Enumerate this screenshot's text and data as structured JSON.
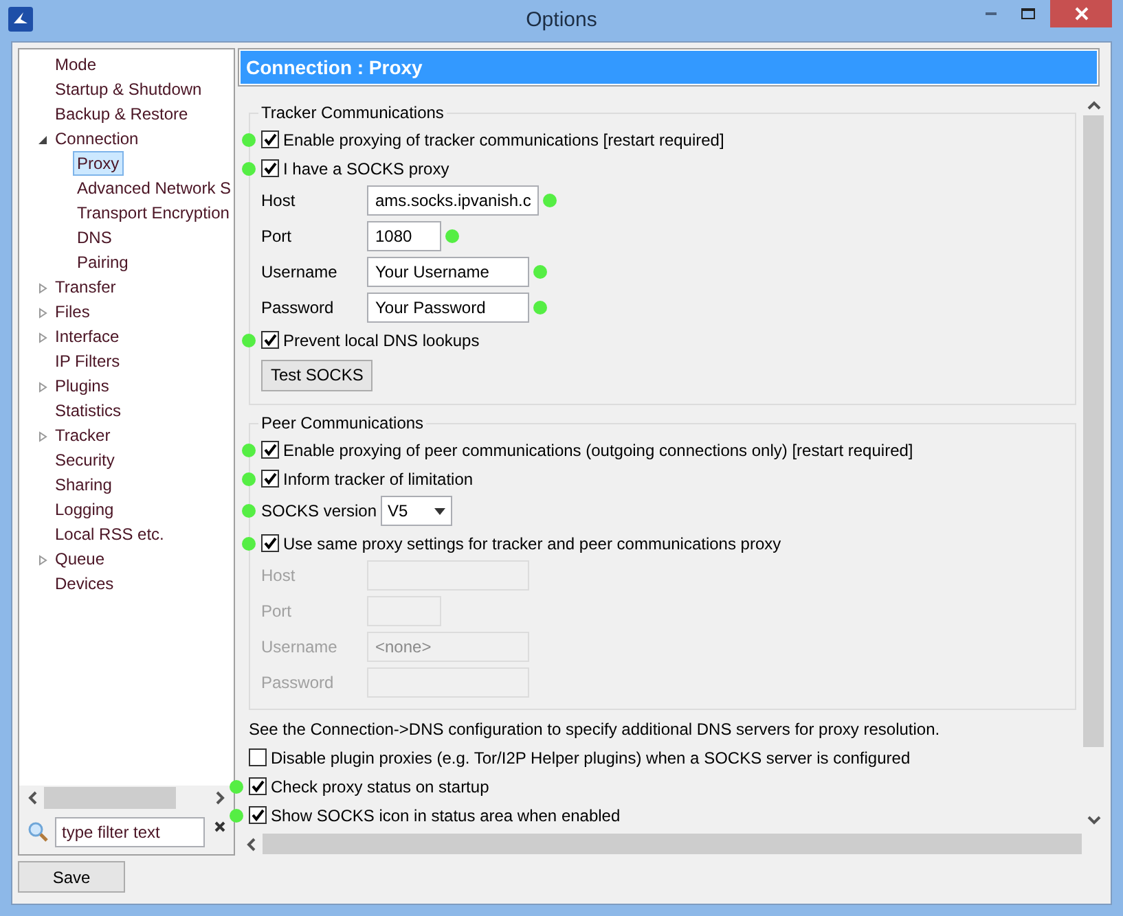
{
  "window": {
    "title": "Options"
  },
  "sidebar": {
    "items": [
      {
        "label": "Mode",
        "kind": "page",
        "selected": false
      },
      {
        "label": "Startup & Shutdown",
        "kind": "page",
        "selected": false
      },
      {
        "label": "Backup & Restore",
        "kind": "page",
        "selected": false
      },
      {
        "label": "Connection",
        "kind": "group",
        "expanded": true,
        "selected": false,
        "children": [
          {
            "label": "Proxy",
            "kind": "page",
            "selected": true
          },
          {
            "label": "Advanced Network S",
            "kind": "page",
            "selected": false
          },
          {
            "label": "Transport Encryption",
            "kind": "page",
            "selected": false
          },
          {
            "label": "DNS",
            "kind": "page",
            "selected": false
          },
          {
            "label": "Pairing",
            "kind": "page",
            "selected": false
          }
        ]
      },
      {
        "label": "Transfer",
        "kind": "group",
        "expanded": false,
        "selected": false
      },
      {
        "label": "Files",
        "kind": "group",
        "expanded": false,
        "selected": false
      },
      {
        "label": "Interface",
        "kind": "group",
        "expanded": false,
        "selected": false
      },
      {
        "label": "IP Filters",
        "kind": "page",
        "selected": false
      },
      {
        "label": "Plugins",
        "kind": "group",
        "expanded": false,
        "selected": false
      },
      {
        "label": "Statistics",
        "kind": "page",
        "selected": false
      },
      {
        "label": "Tracker",
        "kind": "group",
        "expanded": false,
        "selected": false
      },
      {
        "label": "Security",
        "kind": "page",
        "selected": false
      },
      {
        "label": "Sharing",
        "kind": "page",
        "selected": false
      },
      {
        "label": "Logging",
        "kind": "page",
        "selected": false
      },
      {
        "label": "Local RSS etc.",
        "kind": "page",
        "selected": false
      },
      {
        "label": "Queue",
        "kind": "group",
        "expanded": false,
        "selected": false
      },
      {
        "label": "Devices",
        "kind": "page",
        "selected": false
      }
    ],
    "filter": {
      "value": "type filter text"
    }
  },
  "content": {
    "header": "Connection : Proxy",
    "tracker": {
      "title": "Tracker Communications",
      "rows": [
        {
          "kind": "checkbox",
          "label": "Enable proxying of tracker communications [restart required]",
          "checked": true,
          "marker": true
        },
        {
          "kind": "checkbox",
          "label": "I have a SOCKS proxy",
          "checked": true,
          "marker": true
        },
        {
          "kind": "field",
          "label": "Host",
          "value": "ams.socks.ipvanish.c",
          "disabled": false,
          "marker": true
        },
        {
          "kind": "short_field",
          "label": "Port",
          "value": "1080",
          "disabled": false,
          "marker": true
        },
        {
          "kind": "field",
          "label": "Username",
          "value": "Your Username",
          "disabled": false,
          "marker": true
        },
        {
          "kind": "field",
          "label": "Password",
          "value": "Your Password",
          "disabled": false,
          "marker": true
        },
        {
          "kind": "checkbox",
          "label": "Prevent local DNS lookups",
          "checked": true,
          "marker": true
        },
        {
          "kind": "button",
          "label": "Test SOCKS"
        }
      ]
    },
    "peer": {
      "title": "Peer Communications",
      "rows": [
        {
          "kind": "checkbox",
          "label": "Enable proxying of peer communications (outgoing connections only) [restart required]",
          "checked": true,
          "marker": true
        },
        {
          "kind": "checkbox",
          "label": "Inform tracker of limitation",
          "checked": true,
          "marker": true
        },
        {
          "kind": "select",
          "label": "SOCKS version",
          "value": "V5",
          "marker": true
        },
        {
          "kind": "checkbox",
          "label": "Use same proxy settings for tracker and peer communications proxy",
          "checked": true,
          "marker": true
        },
        {
          "kind": "field",
          "label": "Host",
          "disabled": true,
          "marker": false
        },
        {
          "kind": "short_field",
          "label": "Port",
          "disabled": true,
          "marker": false
        },
        {
          "kind": "field",
          "label": "Username",
          "value": "<none>",
          "disabled": true,
          "marker": false
        },
        {
          "kind": "field",
          "label": "Password",
          "disabled": true,
          "marker": false
        }
      ]
    },
    "options": [
      {
        "kind": "note",
        "label": "See the Connection->DNS configuration to specify additional DNS servers for proxy resolution."
      },
      {
        "kind": "checkbox",
        "label": "Disable plugin proxies (e.g. Tor/I2P Helper plugins) when a SOCKS server is configured",
        "checked": false,
        "marker": false
      },
      {
        "kind": "checkbox",
        "label": "Check proxy status on startup",
        "checked": true,
        "marker": true
      },
      {
        "kind": "checkbox",
        "label": "Show SOCKS icon in status area when enabled",
        "checked": true,
        "marker": true
      }
    ]
  },
  "buttons": [
    {
      "label": "Save"
    }
  ]
}
